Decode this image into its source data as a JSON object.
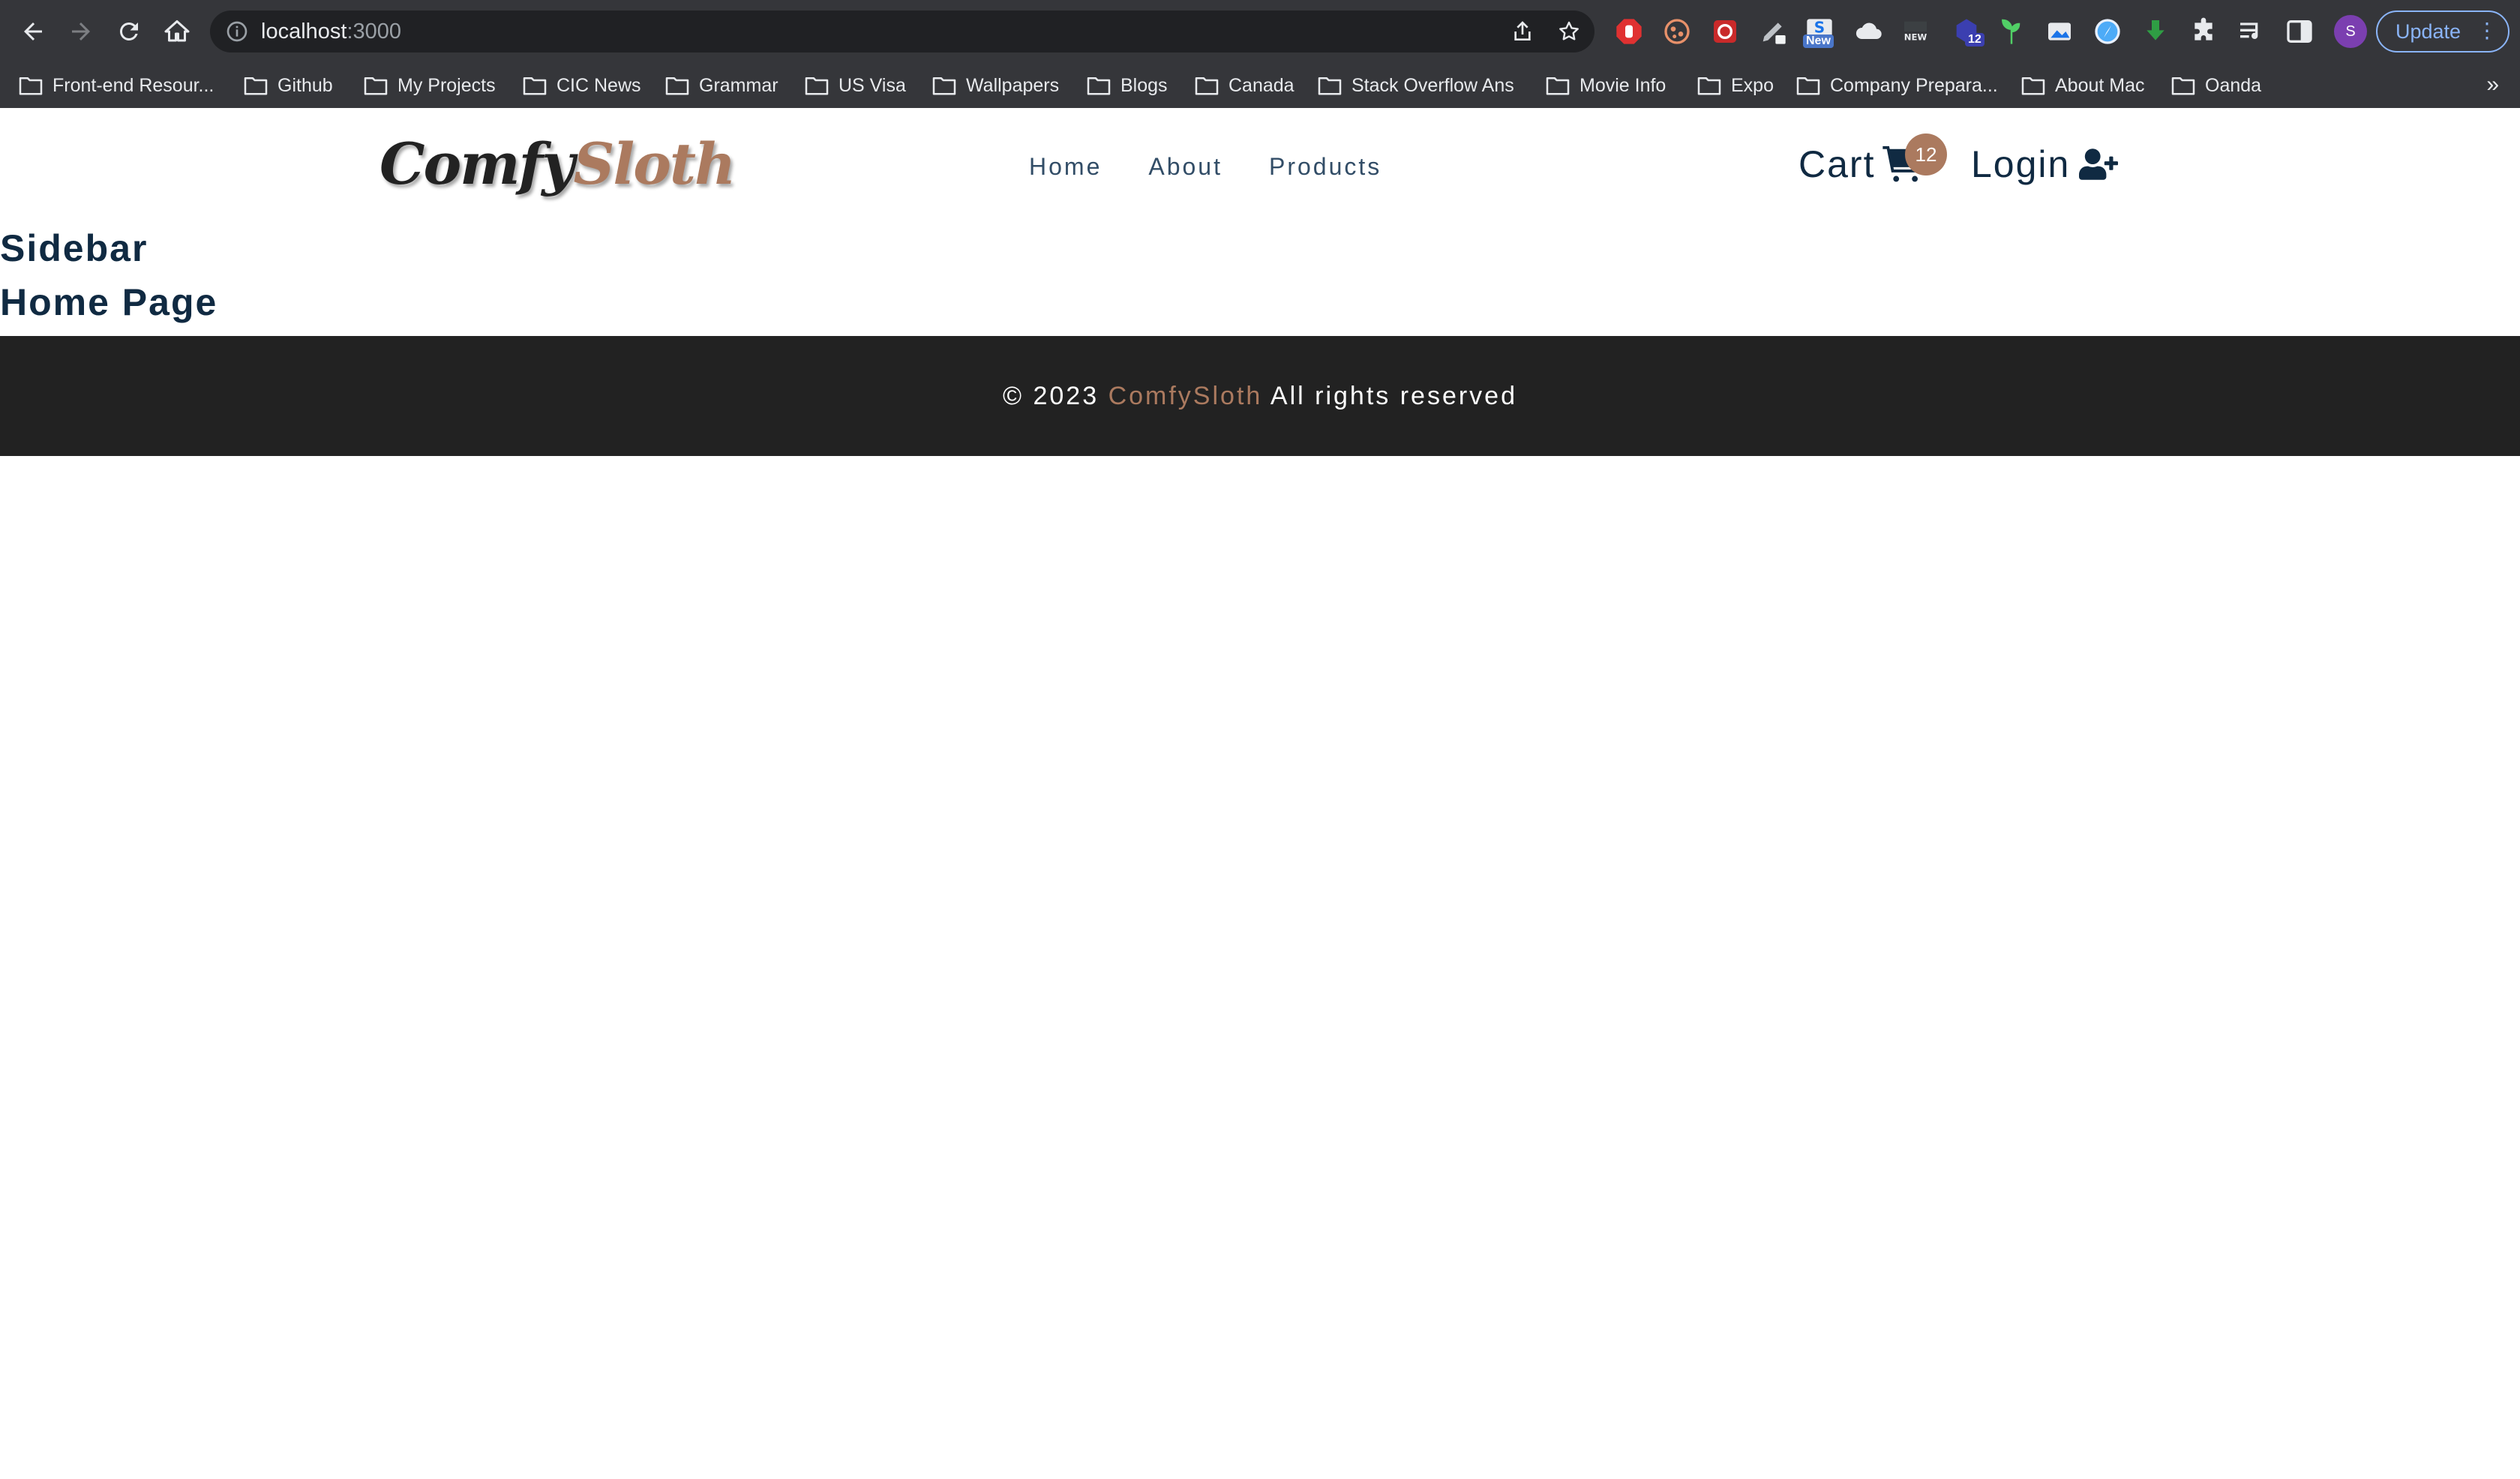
{
  "browser": {
    "url_host": "localhost",
    "url_port": ":3000",
    "update_label": "Update",
    "profile_initial": "S",
    "extension_badges": {
      "new": "New",
      "count": "12",
      "new_small": "NEW"
    },
    "bookmarks": [
      "Front-end Resour...",
      "Github",
      "My Projects",
      "CIC News",
      "Grammar",
      "US Visa",
      "Wallpapers",
      "Blogs",
      "Canada",
      "Stack Overflow Ans",
      "Movie Info",
      "Expo",
      "Company Prepara...",
      "About Mac",
      "Oanda"
    ],
    "more_bookmarks": "»"
  },
  "navbar": {
    "logo_part1": "Comfy",
    "logo_part2": "Sloth",
    "links": [
      "Home",
      "About",
      "Products"
    ],
    "cart_label": "Cart",
    "cart_count": "12",
    "login_label": "Login"
  },
  "main": {
    "sidebar_heading": "Sidebar",
    "page_heading": "Home Page"
  },
  "footer": {
    "prefix": "© 2023",
    "brand": "ComfySloth",
    "suffix": "All rights reserved"
  },
  "colors": {
    "brand": "#ab7a5f",
    "heading": "#102a42",
    "footer_bg": "#222222",
    "chrome_bg": "#35363a"
  }
}
